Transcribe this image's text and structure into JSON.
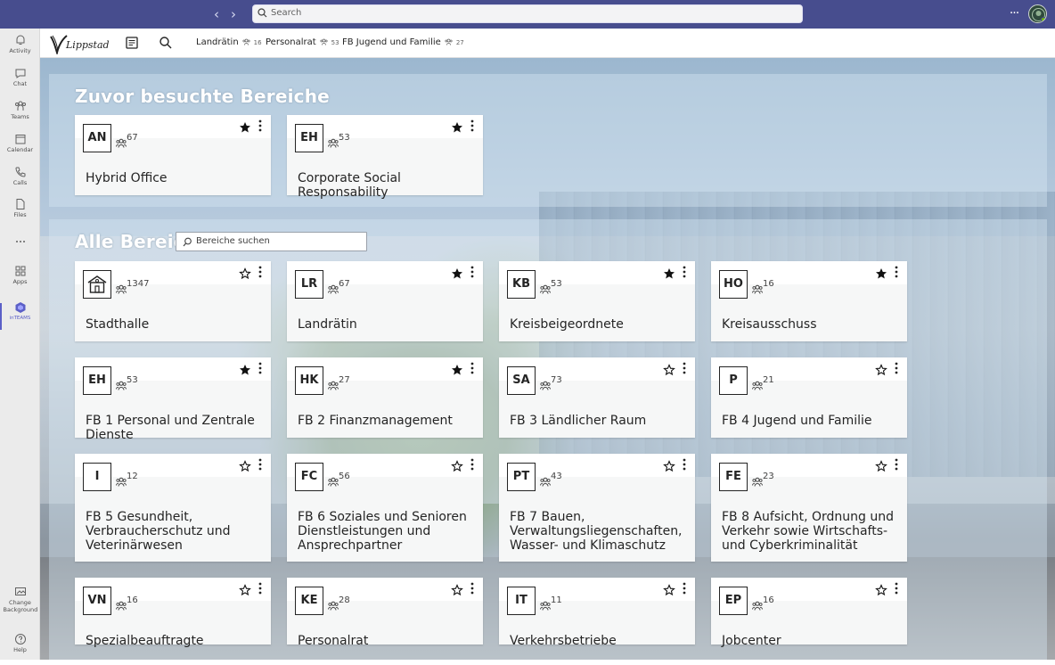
{
  "titlebar": {
    "search_placeholder": "Search",
    "more_label": "···",
    "colors": {
      "bar": "#474d8e"
    }
  },
  "rail": {
    "items": [
      {
        "label": "Activity",
        "icon": "bell-icon"
      },
      {
        "label": "Chat",
        "icon": "chat-icon"
      },
      {
        "label": "Teams",
        "icon": "teams-icon"
      },
      {
        "label": "Calendar",
        "icon": "calendar-icon"
      },
      {
        "label": "Calls",
        "icon": "phone-icon"
      },
      {
        "label": "Files",
        "icon": "file-icon"
      },
      {
        "label": "",
        "icon": "more-icon"
      },
      {
        "label": "Apps",
        "icon": "apps-icon"
      },
      {
        "label": "inTEAMS",
        "icon": "inteams-icon"
      }
    ],
    "bottom": [
      {
        "label": "Change Background",
        "icon": "change-background-icon"
      },
      {
        "label": "Help",
        "icon": "help-icon"
      }
    ]
  },
  "apptabs": {
    "logo": "Lippstadt",
    "tabs": [
      {
        "label": "Landrätin",
        "count": "16"
      },
      {
        "label": "Personalrat",
        "count": "53"
      },
      {
        "label": "FB Jugend und Familie",
        "count": "27"
      }
    ]
  },
  "recent": {
    "title": "Zuvor besuchte Bereiche",
    "cards": [
      {
        "abbr": "AN",
        "members": "67",
        "name": "Hybrid Office",
        "favorite": true
      },
      {
        "abbr": "EH",
        "members": "53",
        "name": "Corporate Social Responsability",
        "favorite": true
      }
    ]
  },
  "all": {
    "title": "Alle Bereiche",
    "search_placeholder": "Bereiche suchen",
    "cards": [
      {
        "abbr": "",
        "image": "building-icon",
        "members": "1347",
        "name": "Stadthalle",
        "favorite": false
      },
      {
        "abbr": "LR",
        "members": "67",
        "name": "Landrätin",
        "favorite": true
      },
      {
        "abbr": "KB",
        "members": "53",
        "name": "Kreisbeigeordnete",
        "favorite": true
      },
      {
        "abbr": "HO",
        "members": "16",
        "name": "Kreisausschuss",
        "favorite": true
      },
      {
        "abbr": "EH",
        "members": "53",
        "name": "FB 1 Personal und Zentrale Dienste",
        "favorite": true
      },
      {
        "abbr": "HK",
        "members": "27",
        "name": "FB 2 Finanzmanagement",
        "favorite": true
      },
      {
        "abbr": "SA",
        "members": "73",
        "name": "FB 3 Ländlicher Raum",
        "favorite": false
      },
      {
        "abbr": "P",
        "members": "21",
        "name": "FB 4 Jugend und Familie",
        "favorite": false
      },
      {
        "abbr": "I",
        "members": "12",
        "name": "FB 5 Gesundheit, Verbraucherschutz und Veterinärwesen",
        "favorite": false
      },
      {
        "abbr": "FC",
        "members": "56",
        "name": "FB 6 Soziales und Senioren Dienstleistungen und Ansprechpartner",
        "favorite": false
      },
      {
        "abbr": "PT",
        "members": "43",
        "name": "FB 7 Bauen, Verwaltungsliegenschaften, Wasser- und Klimaschutz",
        "favorite": false
      },
      {
        "abbr": "FE",
        "members": "23",
        "name": "FB 8 Aufsicht, Ordnung und Verkehr sowie Wirtschafts- und Cyberkriminalität",
        "favorite": false
      },
      {
        "abbr": "VN",
        "members": "16",
        "name": "Spezialbeauftragte",
        "favorite": false
      },
      {
        "abbr": "KE",
        "members": "28",
        "name": "Personalrat",
        "favorite": false
      },
      {
        "abbr": "IT",
        "members": "11",
        "name": "Verkehrsbetriebe",
        "favorite": false
      },
      {
        "abbr": "EP",
        "members": "16",
        "name": "Jobcenter",
        "favorite": false
      }
    ]
  }
}
